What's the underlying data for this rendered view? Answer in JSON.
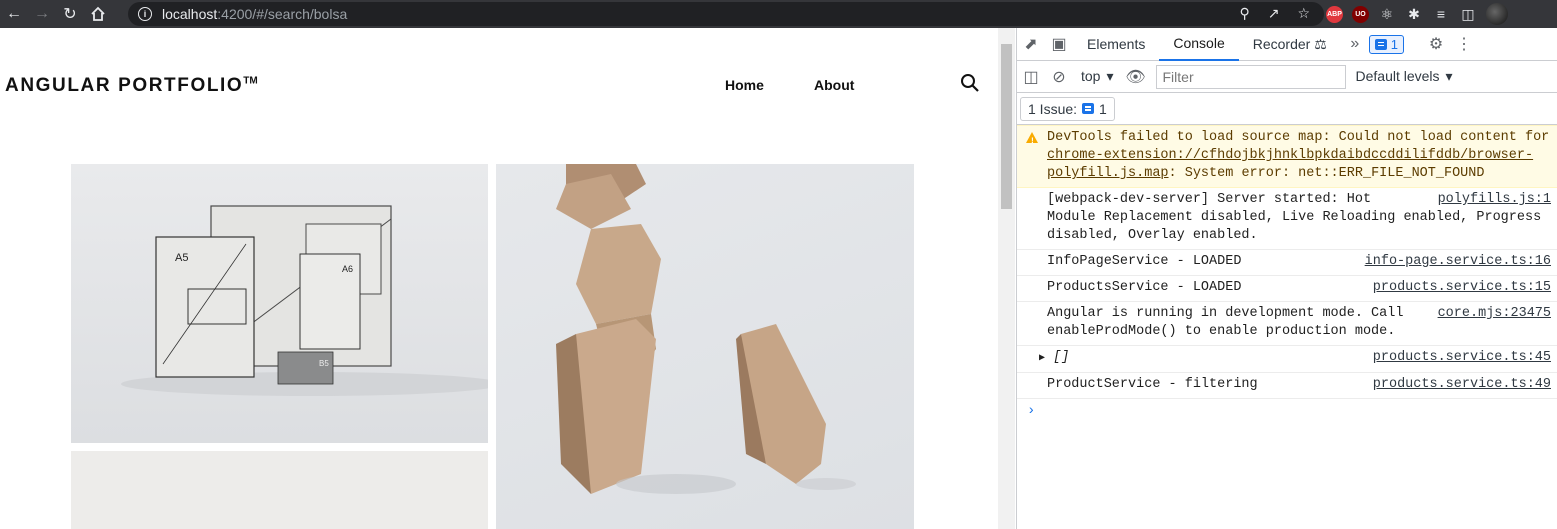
{
  "browser": {
    "url_host": "localhost",
    "url_rest": ":4200/#/search/bolsa",
    "extensions": [
      {
        "name": "adblock-plus",
        "label": "ABP",
        "color": "#e0383e"
      },
      {
        "name": "ublock",
        "label": "UO",
        "color": "#800000"
      }
    ]
  },
  "page": {
    "brand": "ANGULAR PORTFOLIO",
    "brand_tm": "TM",
    "nav": {
      "home": "Home",
      "about": "About"
    },
    "cards": [
      {
        "name": "stationery-mockup",
        "labels": [
          "A5",
          "A6",
          "B5"
        ]
      },
      {
        "name": "wooden-blocks"
      },
      {
        "name": "light-product"
      }
    ]
  },
  "devtools": {
    "tabs": [
      "Elements",
      "Console",
      "Recorder"
    ],
    "active_tab": "Console",
    "issues_count": "1",
    "context": "top",
    "filter_placeholder": "Filter",
    "levels": "Default levels",
    "issues_label": "1 Issue:",
    "messages": {
      "warn_text_1": "DevTools failed to load source map: Could not load content for ",
      "warn_link": "chrome-extension://cfhdojbkjhnklbpkdaibdccddilifddb/browser-polyfill.js.map",
      "warn_text_2": ": System error: net::ERR_FILE_NOT_FOUND",
      "log1_text": "[webpack-dev-server] Server started: Hot Module Replacement disabled, Live Reloading enabled, Progress disabled, Overlay enabled.",
      "log1_src": "polyfills.js:1",
      "log2_text": "InfoPageService - LOADED",
      "log2_src": "info-page.service.ts:16",
      "log3_text": "ProductsService - LOADED",
      "log3_src": "products.service.ts:15",
      "log4_text": "Angular is running in development mode. Call enableProdMode() to enable production mode.",
      "log4_src": "core.mjs:23475",
      "log5_text": "[]",
      "log5_src": "products.service.ts:45",
      "log6_text": "ProductService - filtering",
      "log6_src": "products.service.ts:49"
    }
  }
}
